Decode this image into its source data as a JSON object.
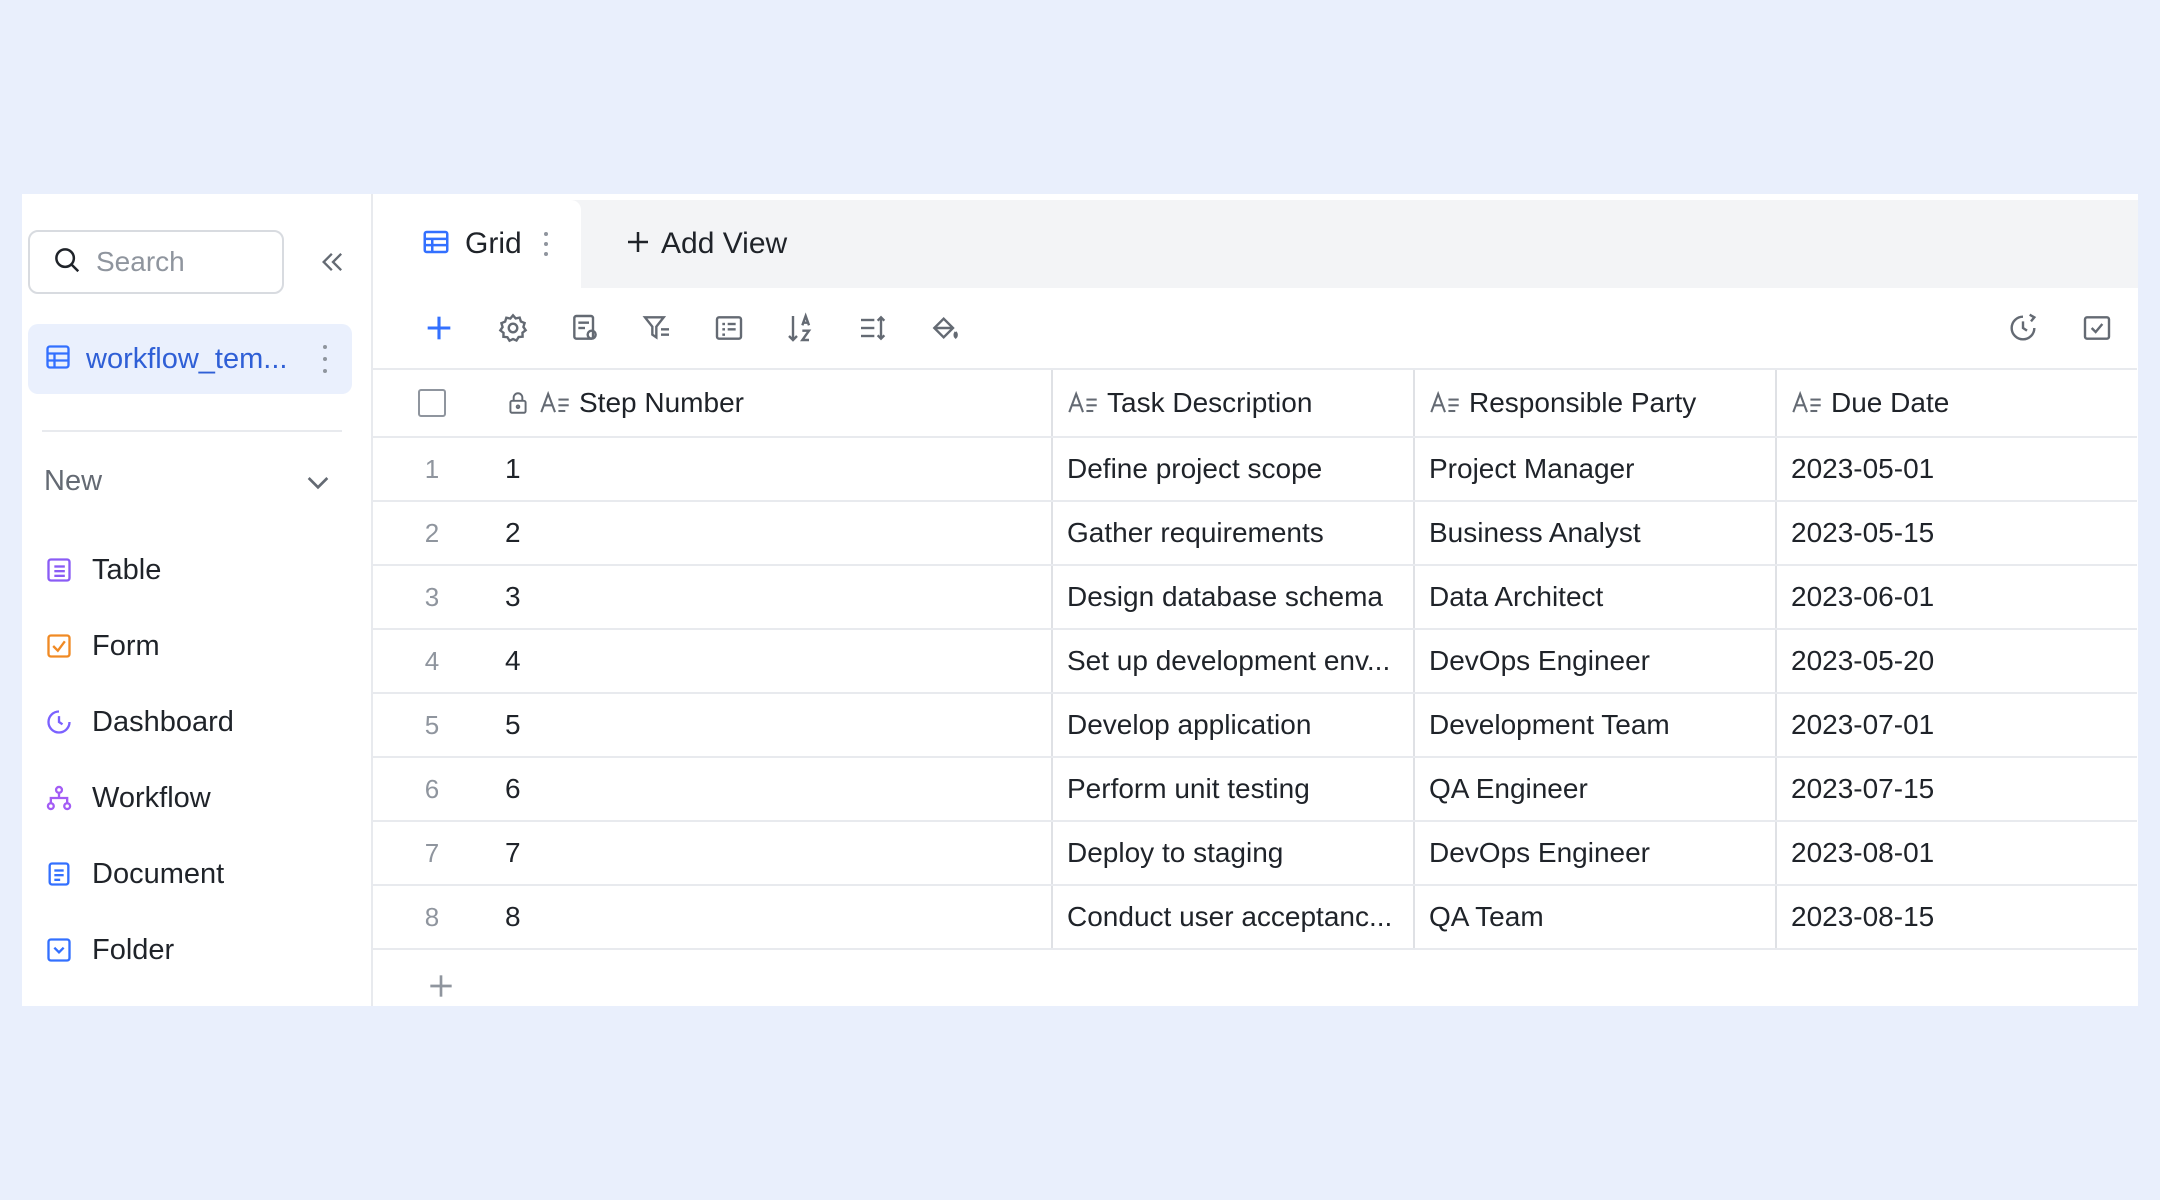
{
  "sidebar": {
    "search_placeholder": "Search",
    "active_table": "workflow_tem...",
    "new_label": "New",
    "items": [
      {
        "label": "Table",
        "icon": "table-icon",
        "color": "#8a5cf5"
      },
      {
        "label": "Form",
        "icon": "form-icon",
        "color": "#f08a24"
      },
      {
        "label": "Dashboard",
        "icon": "dashboard-icon",
        "color": "#7b61ff"
      },
      {
        "label": "Workflow",
        "icon": "workflow-icon",
        "color": "#a35cf5"
      },
      {
        "label": "Document",
        "icon": "document-icon",
        "color": "#3370ff"
      },
      {
        "label": "Folder",
        "icon": "folder-icon",
        "color": "#3370ff"
      }
    ]
  },
  "tabs": {
    "grid_label": "Grid",
    "add_view_label": "Add View"
  },
  "grid": {
    "columns": [
      "Step Number",
      "Task Description",
      "Responsible Party",
      "Due Date"
    ],
    "rows": [
      {
        "index": "1",
        "step": "1",
        "task": "Define project scope",
        "party": "Project Manager",
        "due": "2023-05-01"
      },
      {
        "index": "2",
        "step": "2",
        "task": "Gather requirements",
        "party": "Business Analyst",
        "due": "2023-05-15"
      },
      {
        "index": "3",
        "step": "3",
        "task": "Design database schema",
        "party": "Data Architect",
        "due": "2023-06-01"
      },
      {
        "index": "4",
        "step": "4",
        "task": "Set up development env...",
        "party": "DevOps Engineer",
        "due": "2023-05-20"
      },
      {
        "index": "5",
        "step": "5",
        "task": "Develop application",
        "party": "Development Team",
        "due": "2023-07-01"
      },
      {
        "index": "6",
        "step": "6",
        "task": "Perform unit testing",
        "party": "QA Engineer",
        "due": "2023-07-15"
      },
      {
        "index": "7",
        "step": "7",
        "task": "Deploy to staging",
        "party": "DevOps Engineer",
        "due": "2023-08-01"
      },
      {
        "index": "8",
        "step": "8",
        "task": "Conduct user acceptanc...",
        "party": "QA Team",
        "due": "2023-08-15"
      }
    ]
  },
  "colors": {
    "accent": "#3370ff",
    "background": "#e9effc"
  }
}
